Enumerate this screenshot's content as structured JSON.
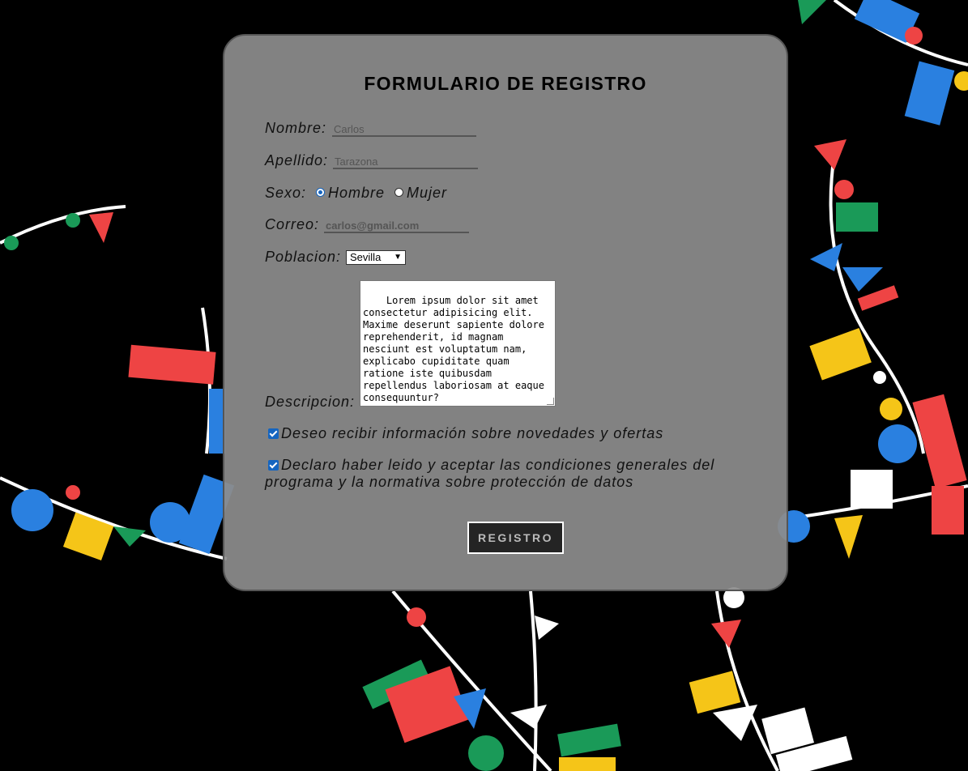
{
  "form": {
    "title": "FORMULARIO DE REGISTRO",
    "nombre": {
      "label": "Nombre:",
      "value": "Carlos"
    },
    "apellido": {
      "label": "Apellido:",
      "value": "Tarazona"
    },
    "sexo": {
      "label": "Sexo:",
      "options": [
        "Hombre",
        "Mujer"
      ],
      "selected": "Hombre"
    },
    "correo": {
      "label": "Correo:",
      "value": "carlos@gmail.com"
    },
    "poblacion": {
      "label": "Poblacion:",
      "selected": "Sevilla"
    },
    "descripcion": {
      "label": "Descripcion:",
      "value": "Lorem ipsum dolor sit amet consectetur adipisicing elit. Maxime deserunt sapiente dolore reprehenderit, id magnam nesciunt est voluptatum nam, explicabo cupiditate quam ratione iste quibusdam repellendus laboriosam at eaque consequuntur?"
    },
    "checkboxes": [
      {
        "label": "Deseo recibir información sobre novedades y ofertas",
        "checked": true
      },
      {
        "label": "Declaro haber leido y aceptar las condiciones generales del programa y la normativa sobre protección de datos",
        "checked": true
      }
    ],
    "submit_label": "REGISTRO"
  },
  "colors": {
    "background": "#000000",
    "card": "#8c8c8c",
    "accent": "#1565c0",
    "button": "#242424"
  }
}
